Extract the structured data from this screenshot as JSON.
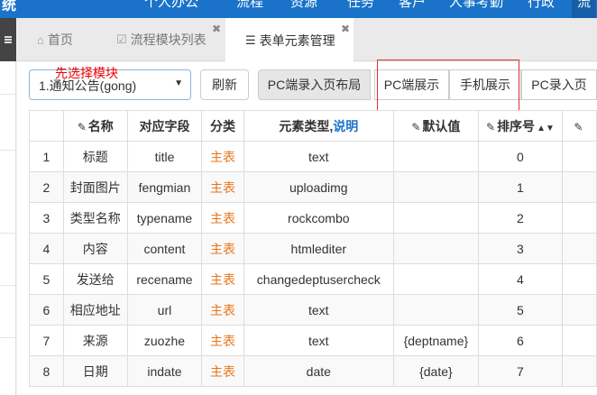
{
  "topnav": {
    "brand": "统",
    "items": [
      "个人办公",
      "流程",
      "资源",
      "任务",
      "客户",
      "人事考勤",
      "行政",
      "流"
    ]
  },
  "tabs": [
    {
      "label": "首页",
      "icon": "home-icon",
      "closable": false
    },
    {
      "label": "流程模块列表",
      "icon": "check-square-icon",
      "closable": true
    },
    {
      "label": "表单元素管理",
      "icon": "list-icon",
      "closable": true
    }
  ],
  "toolbar": {
    "module_select_value": "1.通知公告(gong)",
    "hint": "先选择模块",
    "refresh_label": "刷新",
    "pc_input_layout_label": "PC端录入页布局",
    "pc_display_label": "PC端展示",
    "mobile_display_label": "手机展示",
    "pc_input_page_label": "PC录入页"
  },
  "table": {
    "headers": {
      "name": "名称",
      "field": "对应字段",
      "category": "分类",
      "type": "元素类型,",
      "type_link": "说明",
      "default": "默认值",
      "sort": "排序号"
    },
    "rows": [
      {
        "no": "1",
        "name": "标题",
        "field": "title",
        "category": "主表",
        "type": "text",
        "default": "",
        "sort": "0"
      },
      {
        "no": "2",
        "name": "封面图片",
        "field": "fengmian",
        "category": "主表",
        "type": "uploadimg",
        "default": "",
        "sort": "1"
      },
      {
        "no": "3",
        "name": "类型名称",
        "field": "typename",
        "category": "主表",
        "type": "rockcombo",
        "default": "",
        "sort": "2"
      },
      {
        "no": "4",
        "name": "内容",
        "field": "content",
        "category": "主表",
        "type": "htmlediter",
        "default": "",
        "sort": "3"
      },
      {
        "no": "5",
        "name": "发送给",
        "field": "recename",
        "category": "主表",
        "type": "changedeptusercheck",
        "default": "",
        "sort": "4"
      },
      {
        "no": "6",
        "name": "相应地址",
        "field": "url",
        "category": "主表",
        "type": "text",
        "default": "",
        "sort": "5"
      },
      {
        "no": "7",
        "name": "来源",
        "field": "zuozhe",
        "category": "主表",
        "type": "text",
        "default": "{deptname}",
        "sort": "6"
      },
      {
        "no": "8",
        "name": "日期",
        "field": "indate",
        "category": "主表",
        "type": "date",
        "default": "{date}",
        "sort": "7"
      }
    ]
  }
}
